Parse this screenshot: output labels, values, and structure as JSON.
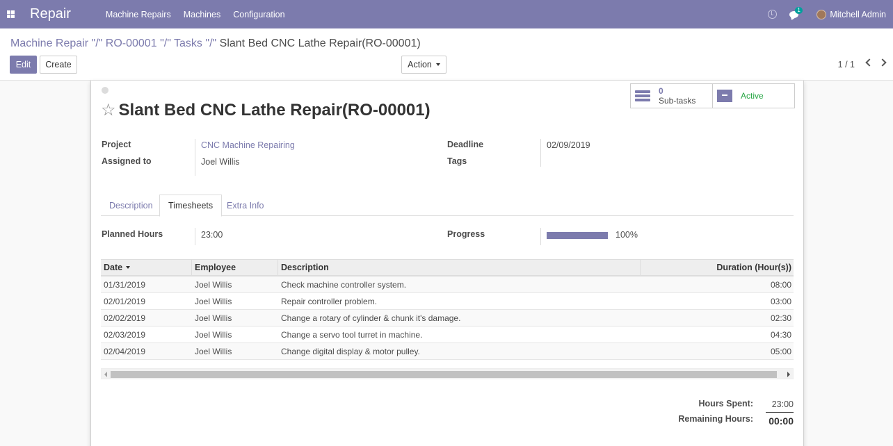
{
  "navbar": {
    "app_name": "Repair",
    "menu": [
      "Machine Repairs",
      "Machines",
      "Configuration"
    ],
    "chat_count": "1",
    "user": "Mitchell Admin",
    "colors": {
      "primary": "#7c7bad"
    }
  },
  "breadcrumb": {
    "items": [
      "Machine Repair",
      "\"/\"",
      "RO-00001",
      "\"/\"",
      "Tasks",
      "\"/\""
    ],
    "current": "Slant Bed CNC Lathe Repair(RO-00001)"
  },
  "toolbar": {
    "edit_label": "Edit",
    "create_label": "Create",
    "action_label": "Action",
    "pager": "1 / 1"
  },
  "stats": {
    "subtasks_count": "0",
    "subtasks_label": "Sub-tasks",
    "active_label": "Active"
  },
  "record": {
    "title": "Slant Bed CNC Lathe Repair(RO-00001)",
    "project_label": "Project",
    "project": "CNC Machine Repairing",
    "assigned_label": "Assigned to",
    "assigned": "Joel Willis",
    "deadline_label": "Deadline",
    "deadline": "02/09/2019",
    "tags_label": "Tags"
  },
  "tabs": [
    "Description",
    "Timesheets",
    "Extra Info"
  ],
  "timesheets": {
    "planned_label": "Planned Hours",
    "planned": "23:00",
    "progress_label": "Progress",
    "progress_text": "100%",
    "progress_fraction": 1.0,
    "columns": [
      "Date",
      "Employee",
      "Description",
      "Duration (Hour(s))"
    ],
    "rows": [
      [
        "01/31/2019",
        "Joel Willis",
        "Check machine controller system.",
        "08:00"
      ],
      [
        "02/01/2019",
        "Joel Willis",
        "Repair controller problem.",
        "03:00"
      ],
      [
        "02/02/2019",
        "Joel Willis",
        "Change a rotary of cylinder & chunk it's damage.",
        "02:30"
      ],
      [
        "02/03/2019",
        "Joel Willis",
        "Change a servo tool turret in machine.",
        "04:30"
      ],
      [
        "02/04/2019",
        "Joel Willis",
        "Change digital display & motor pulley.",
        "05:00"
      ]
    ],
    "hours_spent_label": "Hours Spent:",
    "hours_spent": "23:00",
    "remaining_label": "Remaining Hours:",
    "remaining": "00:00"
  }
}
